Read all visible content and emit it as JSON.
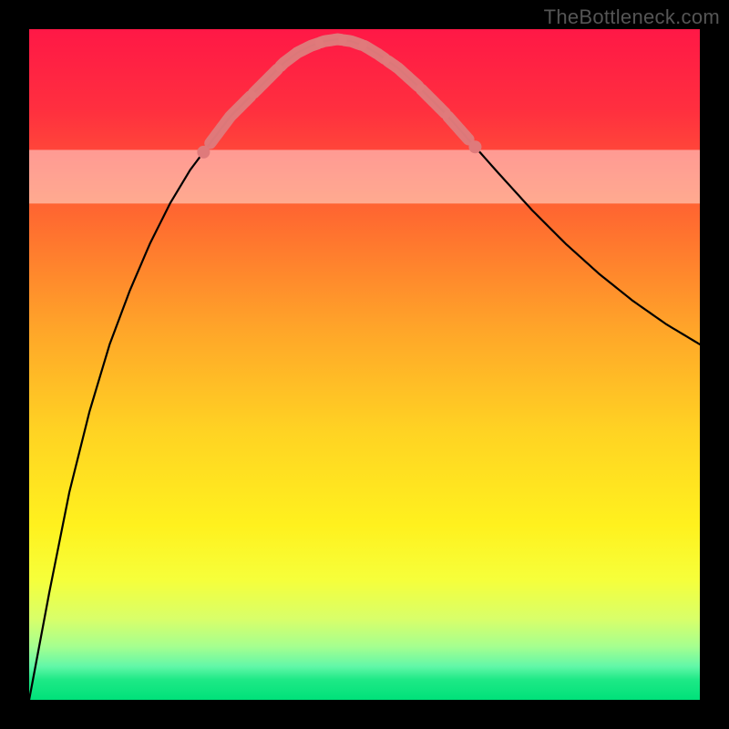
{
  "watermark": "TheBottleneck.com",
  "chart_data": {
    "type": "line",
    "title": "",
    "xlabel": "",
    "ylabel": "",
    "xlim": [
      0,
      100
    ],
    "ylim": [
      0,
      100
    ],
    "x": [
      0,
      3,
      6,
      9,
      12,
      15,
      18,
      21,
      24,
      27,
      30,
      33,
      36,
      38,
      40,
      42,
      44,
      46,
      48,
      50,
      52,
      55,
      58,
      62,
      66,
      70,
      75,
      80,
      85,
      90,
      95,
      100
    ],
    "values": [
      0,
      16,
      31,
      43,
      53,
      61,
      68,
      74,
      79,
      83,
      87,
      90,
      93,
      95,
      96.5,
      97.5,
      98.2,
      98.5,
      98.2,
      97.5,
      96.3,
      94.2,
      91.5,
      87.5,
      83,
      78.5,
      73,
      68,
      63.5,
      59.5,
      56,
      53
    ],
    "annotations": {
      "salmon_segments_x_ranges": [
        [
          27,
          33
        ],
        [
          33.5,
          37
        ],
        [
          37.5,
          43
        ],
        [
          43.5,
          46.5
        ],
        [
          47,
          49.5
        ],
        [
          50,
          53
        ],
        [
          53.5,
          58
        ],
        [
          58.5,
          62
        ],
        [
          62.5,
          65.5
        ]
      ],
      "salmon_dot_first_x": 26,
      "salmon_dot_last_x": 66.5
    },
    "gradient_stops": [
      {
        "offset": 0.0,
        "color": "#ff1846"
      },
      {
        "offset": 0.12,
        "color": "#ff2f3f"
      },
      {
        "offset": 0.28,
        "color": "#ff6a30"
      },
      {
        "offset": 0.45,
        "color": "#ffa629"
      },
      {
        "offset": 0.6,
        "color": "#ffd323"
      },
      {
        "offset": 0.74,
        "color": "#fff11e"
      },
      {
        "offset": 0.82,
        "color": "#f6ff3a"
      },
      {
        "offset": 0.88,
        "color": "#d8ff6a"
      },
      {
        "offset": 0.92,
        "color": "#a6ff8f"
      },
      {
        "offset": 0.95,
        "color": "#62f7a8"
      },
      {
        "offset": 0.97,
        "color": "#1ee986"
      },
      {
        "offset": 1.0,
        "color": "#00e17a"
      }
    ],
    "white_band_y_range": [
      74,
      82
    ],
    "curve_color": "#000000",
    "marker_color": "#df7a7b"
  }
}
